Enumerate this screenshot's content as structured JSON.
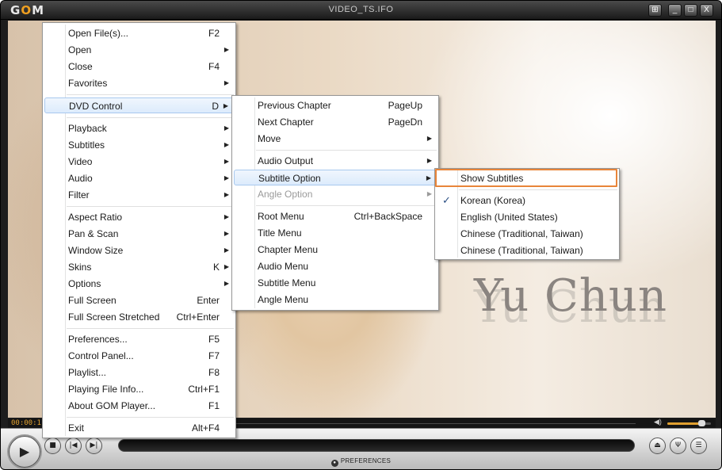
{
  "window": {
    "logo": "GOM",
    "title": "VIDEO_TS.IFO",
    "buttons": {
      "special": "⊞",
      "minimize": "_",
      "maximize": "□",
      "close": "X"
    }
  },
  "video": {
    "caption": "Yu Chun"
  },
  "timebar": {
    "time": "00:00:1",
    "volume_fraction": 0.8
  },
  "controls": {
    "play": "▶",
    "stop": "■",
    "prev": "|◀",
    "next": "▶|",
    "eject": "⏏",
    "equalizer": "Ψ",
    "menu": "☰",
    "preferences_label": "PREFERENCES"
  },
  "main_menu": {
    "items": [
      {
        "label": "Open File(s)...",
        "shortcut": "F2"
      },
      {
        "label": "Open",
        "submenu": true
      },
      {
        "label": "Close",
        "shortcut": "F4"
      },
      {
        "label": "Favorites",
        "submenu": true
      },
      {
        "label": "DVD Control",
        "shortcut": "D",
        "submenu": true,
        "highlighted": true
      },
      {
        "label": "Playback",
        "submenu": true
      },
      {
        "label": "Subtitles",
        "submenu": true
      },
      {
        "label": "Video",
        "submenu": true
      },
      {
        "label": "Audio",
        "submenu": true
      },
      {
        "label": "Filter",
        "submenu": true
      },
      {
        "label": "Aspect Ratio",
        "submenu": true
      },
      {
        "label": "Pan & Scan",
        "submenu": true
      },
      {
        "label": "Window Size",
        "submenu": true
      },
      {
        "label": "Skins",
        "shortcut": "K",
        "submenu": true
      },
      {
        "label": "Options",
        "submenu": true
      },
      {
        "label": "Full Screen",
        "shortcut": "Enter"
      },
      {
        "label": "Full Screen Stretched",
        "shortcut": "Ctrl+Enter"
      },
      {
        "label": "Preferences...",
        "shortcut": "F5"
      },
      {
        "label": "Control Panel...",
        "shortcut": "F7"
      },
      {
        "label": "Playlist...",
        "shortcut": "F8"
      },
      {
        "label": "Playing File Info...",
        "shortcut": "Ctrl+F1"
      },
      {
        "label": "About GOM Player...",
        "shortcut": "F1"
      },
      {
        "label": "Exit",
        "shortcut": "Alt+F4"
      }
    ]
  },
  "dvd_menu": {
    "items": [
      {
        "label": "Previous Chapter",
        "shortcut": "PageUp"
      },
      {
        "label": "Next Chapter",
        "shortcut": "PageDn"
      },
      {
        "label": "Move",
        "submenu": true
      },
      {
        "label": "Audio Output",
        "submenu": true
      },
      {
        "label": "Subtitle Option",
        "submenu": true,
        "highlighted": true
      },
      {
        "label": "Angle Option",
        "submenu": true,
        "disabled": true
      },
      {
        "label": "Root Menu",
        "shortcut": "Ctrl+BackSpace"
      },
      {
        "label": "Title Menu"
      },
      {
        "label": "Chapter Menu"
      },
      {
        "label": "Audio Menu"
      },
      {
        "label": "Subtitle Menu"
      },
      {
        "label": "Angle Menu"
      }
    ]
  },
  "subtitle_menu": {
    "items": [
      {
        "label": "Show Subtitles",
        "focused": true
      },
      {
        "label": "Korean (Korea)",
        "checked": true,
        "check_mark": "✓"
      },
      {
        "label": "English (United States)"
      },
      {
        "label": "Chinese (Traditional, Taiwan)"
      },
      {
        "label": "Chinese (Traditional, Taiwan)"
      }
    ]
  },
  "colors": {
    "focus_outline": "#e8853a",
    "highlight": "#dcebfc",
    "time_text": "#e0a030"
  }
}
